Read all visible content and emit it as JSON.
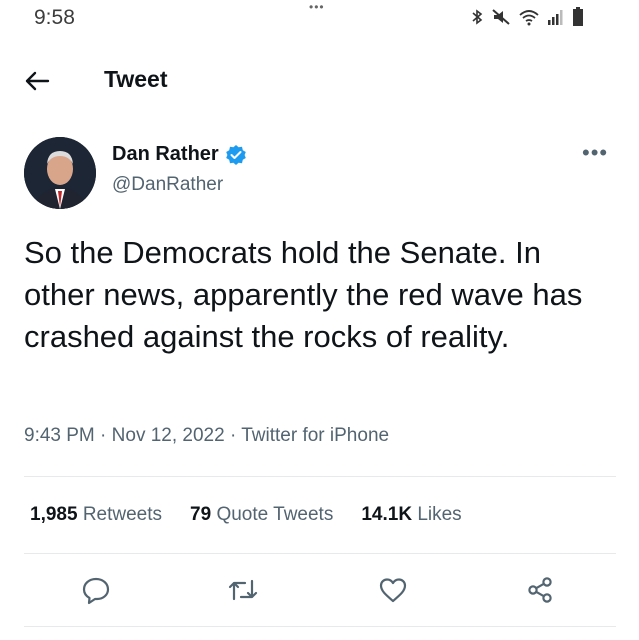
{
  "status_bar": {
    "time": "9:58",
    "notch_dots": "•••",
    "icons": [
      "bluetooth-icon",
      "mute-icon",
      "wifi-icon",
      "signal-icon",
      "battery-icon"
    ]
  },
  "header": {
    "back_icon": "arrow-left-icon",
    "title": "Tweet"
  },
  "tweet": {
    "author_name": "Dan Rather",
    "verified": true,
    "handle": "@DanRather",
    "text": "So the Democrats hold the Senate. In other news, apparently the red wave has crashed against the rocks of reality.",
    "time": "9:43 PM",
    "date": "Nov 12, 2022",
    "source": "Twitter for iPhone",
    "separator": "·"
  },
  "stats": {
    "retweets_count": "1,985",
    "retweets_label": "Retweets",
    "quotes_count": "79",
    "quotes_label": "Quote Tweets",
    "likes_count": "14.1K",
    "likes_label": "Likes"
  },
  "actions": [
    "reply-icon",
    "retweet-icon",
    "like-icon",
    "share-icon"
  ],
  "colors": {
    "accent": "#1d9bf0",
    "secondary_text": "#536471",
    "primary_text": "#0f1419",
    "divider": "#e7e9ea"
  }
}
